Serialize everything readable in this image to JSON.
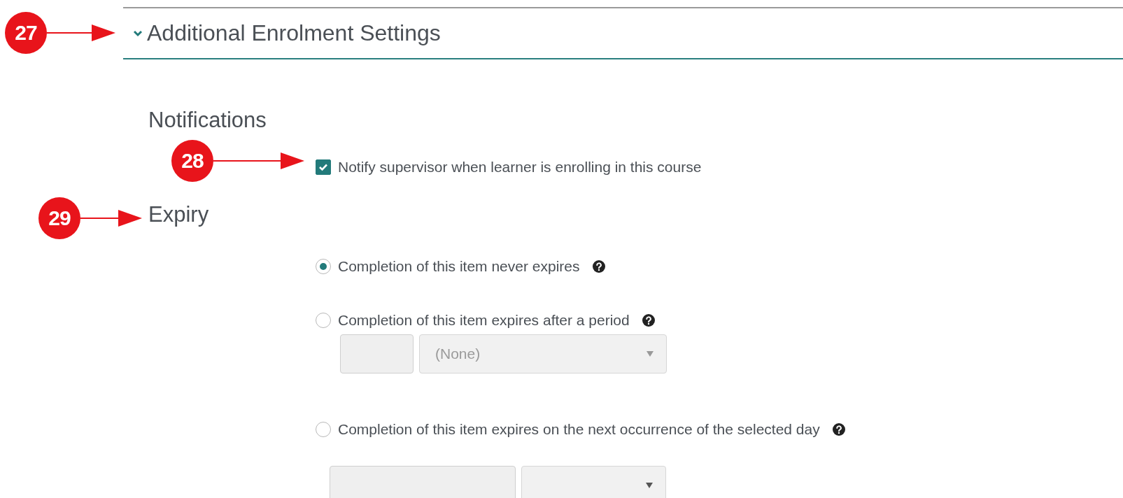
{
  "section": {
    "title": "Additional Enrolment Settings",
    "expanded": true
  },
  "notifications": {
    "heading": "Notifications",
    "checkbox": {
      "label": "Notify supervisor when learner is enrolling in this course",
      "checked": true
    }
  },
  "expiry": {
    "heading": "Expiry",
    "options": [
      {
        "kind": "plain",
        "label": "Completion of this item never expires",
        "selected": true
      },
      {
        "kind": "period",
        "label": "Completion of this item expires after a period",
        "selected": false,
        "select_value": "(None)"
      },
      {
        "kind": "day",
        "label": "Completion of this item expires on the next occurrence of the selected day",
        "selected": false
      }
    ]
  },
  "callouts": [
    {
      "number": "27"
    },
    {
      "number": "28"
    },
    {
      "number": "29"
    }
  ]
}
